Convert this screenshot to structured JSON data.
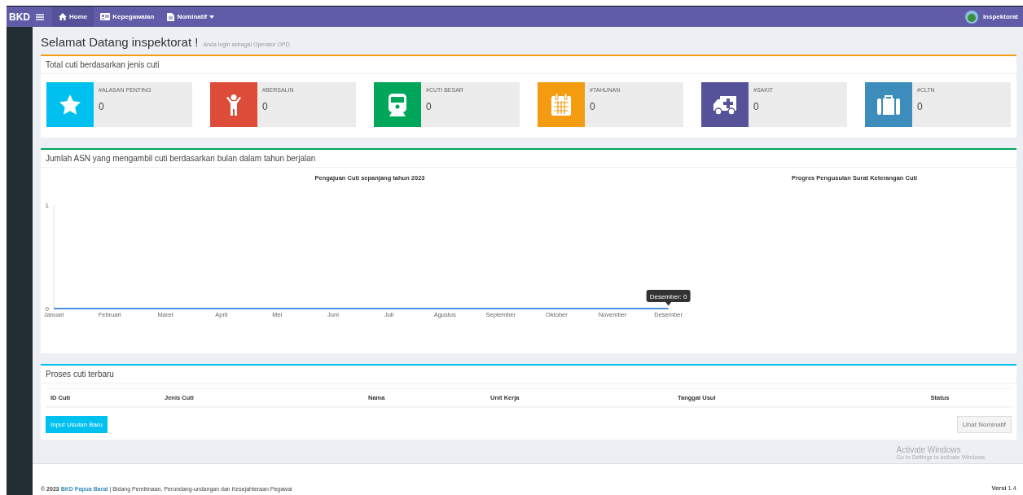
{
  "navbar": {
    "brand": "BKD",
    "menu": [
      {
        "label": "Home",
        "selected": true,
        "dropdown": false
      },
      {
        "label": "Kepegawaian",
        "selected": false,
        "dropdown": false
      },
      {
        "label": "Nominatif",
        "selected": false,
        "dropdown": true
      }
    ],
    "user": "inspektorat"
  },
  "header": {
    "title": "Selamat Datang inspektorat !",
    "subtitle": "Anda login sebagai Operator OPD"
  },
  "summary": {
    "title": "Total cuti berdasarkan jenis cuti",
    "boxes": [
      {
        "kind": "star",
        "label": "#ALASAN PENTING",
        "value": "0",
        "color": "#00c0ef"
      },
      {
        "kind": "child",
        "label": "#BERSALIN",
        "value": "0",
        "color": "#dd4b39"
      },
      {
        "kind": "train",
        "label": "#CUTI BESAR",
        "value": "0",
        "color": "#00a65a"
      },
      {
        "kind": "calendar",
        "label": "#TAHUNAN",
        "value": "0",
        "color": "#f39c12"
      },
      {
        "kind": "ambulance",
        "label": "#SAKIT",
        "value": "0",
        "color": "#555299"
      },
      {
        "kind": "briefcase",
        "label": "#CLTN",
        "value": "0",
        "color": "#3c8dbc"
      }
    ]
  },
  "monthly": {
    "title": "Jumlah ASN yang mengambil cuti berdasarkan bulan dalam tahun berjalan",
    "chart_data": {
      "type": "line",
      "title": "Pengajuan Cuti sepanjang tahun 2023",
      "categories": [
        "Januari",
        "Februari",
        "Maret",
        "April",
        "Mei",
        "Juni",
        "Juli",
        "Agustus",
        "September",
        "Oktober",
        "November",
        "Desember"
      ],
      "series": [
        {
          "color": "#4a90e2",
          "values": [
            0,
            0,
            0,
            0,
            0,
            0,
            0,
            0,
            0,
            0,
            0,
            0
          ]
        }
      ],
      "ylim": [
        0,
        1
      ],
      "yticks": [
        0,
        1
      ]
    },
    "tooltip": "Desember: 0",
    "progress_title": "Progres Pengusulan Surat Keterangan Cuti"
  },
  "recent": {
    "title": "Proses cuti terbaru",
    "columns": [
      "ID Cuti",
      "Jenis Cuti",
      "Nama",
      "Unit Kerja",
      "Tanggal Usul",
      "Status"
    ],
    "add_button": "Input Usulan Baru",
    "list_button": "Lihat Nominatif"
  },
  "windows_notice": {
    "title": "Activate Windows",
    "text": "Go to Settings to activate Windows."
  },
  "footer": {
    "copyright": "© 2023",
    "link": "BKD Papua Barat",
    "text": "| Bidang Pembinaan, Perundang-undangan dan Kesejahteraan Pegawai",
    "version": "**Versi** 1.4"
  }
}
